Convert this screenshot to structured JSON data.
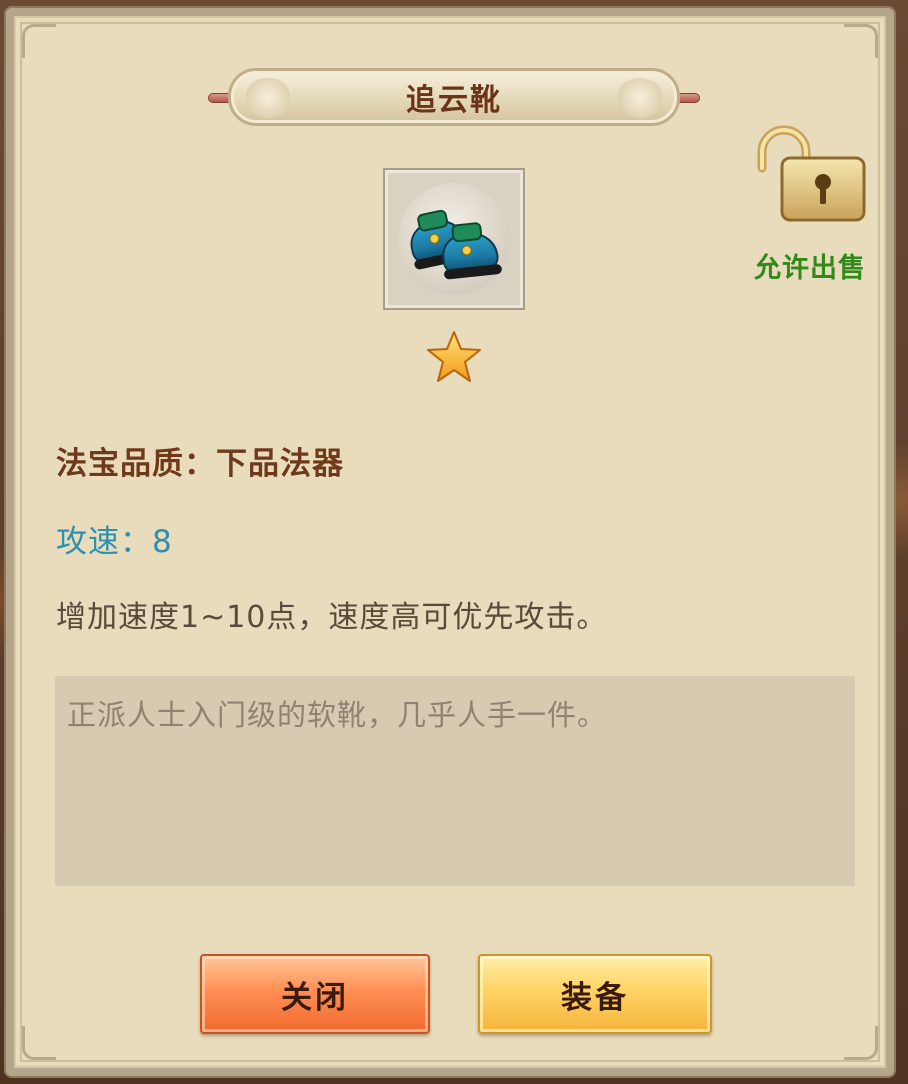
{
  "dialog": {
    "title": "追云靴",
    "item_icon": "boots-icon",
    "stars": 1,
    "lock": {
      "icon": "unlocked-padlock-icon",
      "label": "允许出售"
    },
    "quality_line": "法宝品质：下品法器",
    "speed_line": "攻速：8",
    "effect_line": "增加速度1~10点，速度高可优先攻击。",
    "lore": "正派人士入门级的软靴，几乎人手一件。",
    "buttons": {
      "close_label": "关闭",
      "equip_label": "装备"
    }
  },
  "colors": {
    "panel_bg": "#e8dcbc",
    "quality_text": "#6e3a1a",
    "speed_text": "#2f8fae",
    "sell_label": "#2f8a1a",
    "close_button": "#ff8f55",
    "equip_button": "#ffd464"
  }
}
